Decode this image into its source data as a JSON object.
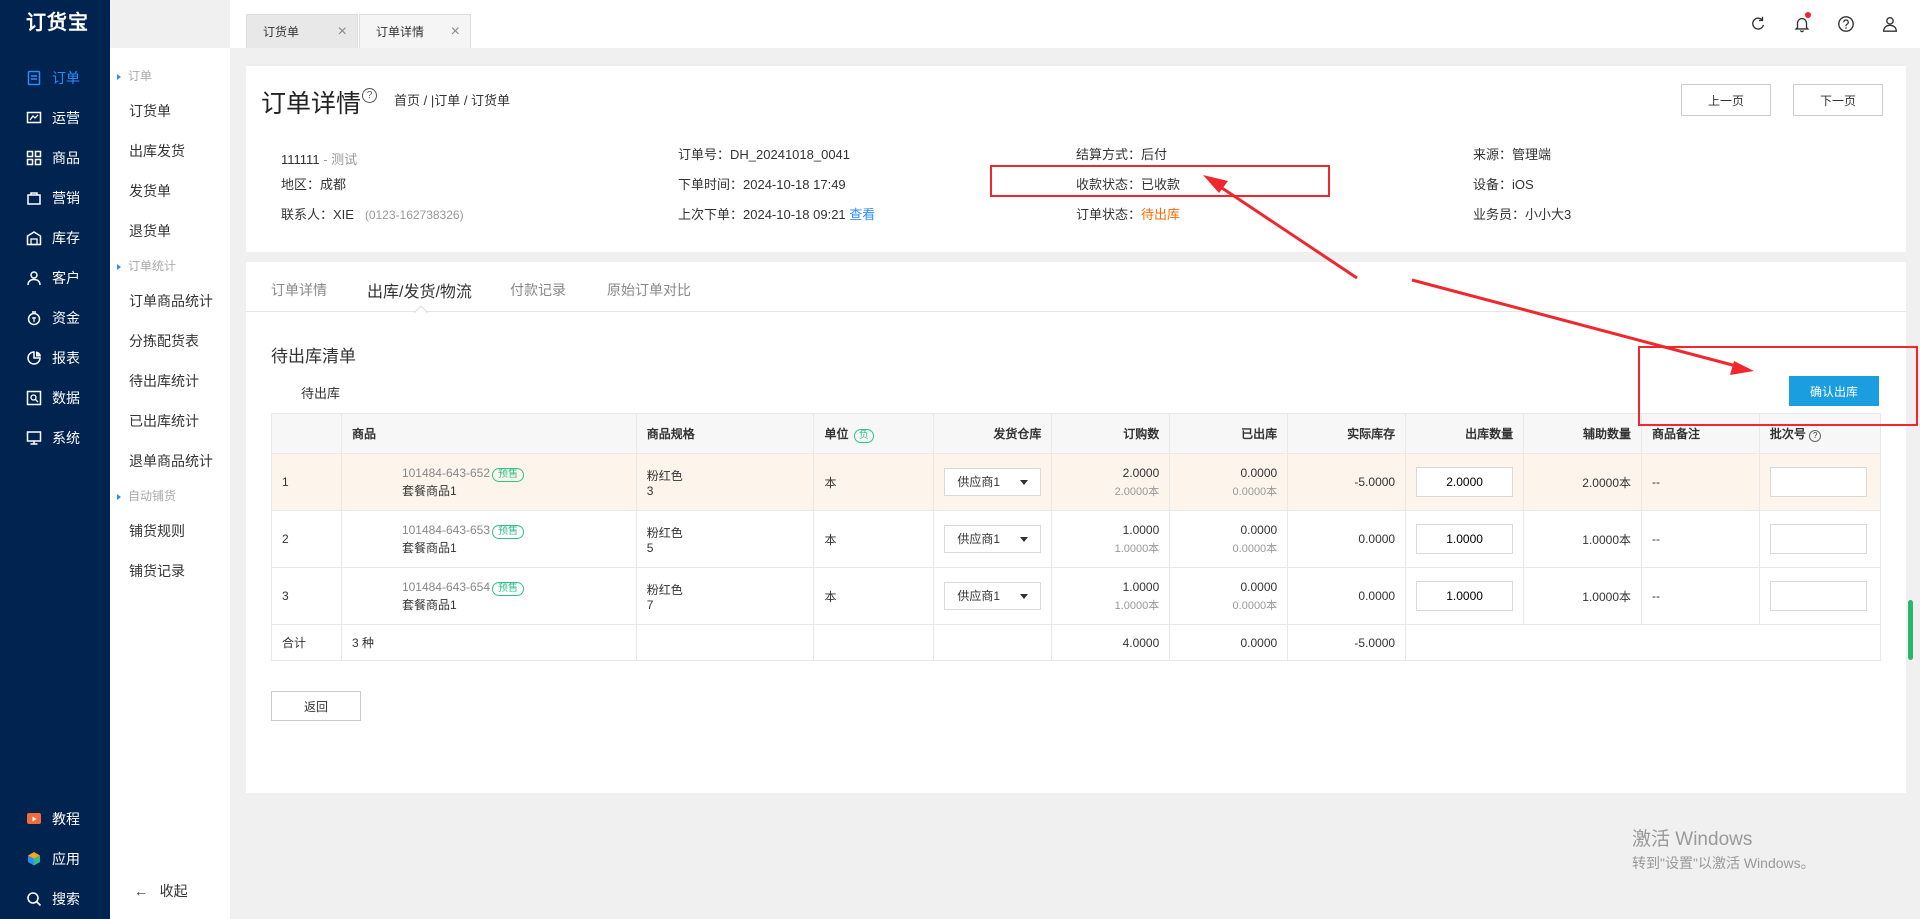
{
  "app": {
    "logo": "订货宝"
  },
  "nav": {
    "items": [
      {
        "label": "订单",
        "icon": "order-icon"
      },
      {
        "label": "运营",
        "icon": "operation-icon"
      },
      {
        "label": "商品",
        "icon": "grid-icon"
      },
      {
        "label": "营销",
        "icon": "marketing-icon"
      },
      {
        "label": "库存",
        "icon": "warehouse-icon"
      },
      {
        "label": "客户",
        "icon": "user-icon"
      },
      {
        "label": "资金",
        "icon": "money-icon"
      },
      {
        "label": "报表",
        "icon": "pie-chart-icon"
      },
      {
        "label": "数据",
        "icon": "data-icon"
      },
      {
        "label": "系统",
        "icon": "monitor-icon"
      }
    ],
    "bottom": [
      {
        "label": "教程",
        "icon": "video-icon"
      },
      {
        "label": "应用",
        "icon": "cube-icon"
      },
      {
        "label": "搜索",
        "icon": "search-icon"
      }
    ],
    "active_color": "#2b8cff"
  },
  "subnav": {
    "groups": [
      {
        "title": "订单",
        "items": [
          "订货单",
          "出库发货",
          "发货单",
          "退货单"
        ]
      },
      {
        "title": "订单统计",
        "items": [
          "订单商品统计",
          "分拣配货表",
          "待出库统计",
          "已出库统计",
          "退单商品统计"
        ]
      },
      {
        "title": "自动铺货",
        "items": [
          "铺货规则",
          "铺货记录"
        ]
      }
    ],
    "collapse": "收起"
  },
  "tabs": [
    {
      "label": "订货单"
    },
    {
      "label": "订单详情"
    }
  ],
  "page": {
    "title": "订单详情",
    "breadcrumb": "首页 / |订单 / 订货单",
    "prev": "上一页",
    "next": "下一页"
  },
  "info": {
    "customer": "111111",
    "customer_note": "- 测试",
    "region_label": "地区：",
    "region": "成都",
    "contact_label": "联系人：",
    "contact": "XIE",
    "contact_phone": "(0123-162738326)",
    "order_no_label": "订单号：",
    "order_no": "DH_20241018_0041",
    "order_time_label": "下单时间：",
    "order_time": "2024-10-18 17:49",
    "last_order_label": "上次下单：",
    "last_order": "2024-10-18 09:21",
    "view": "查看",
    "settle_label": "结算方式：",
    "settle": "后付",
    "pay_status_label": "收款状态：",
    "pay_status": "已收款",
    "order_status_label": "订单状态：",
    "order_status": "待出库",
    "source_label": "来源：",
    "source": "管理端",
    "device_label": "设备：",
    "device": "iOS",
    "sales_label": "业务员：",
    "sales": "小小大3"
  },
  "detail_tabs": [
    "订单详情",
    "出库/发货/物流",
    "付款记录",
    "原始订单对比"
  ],
  "section": {
    "title": "待出库清单",
    "sub_label": "待出库",
    "confirm": "确认出库"
  },
  "table": {
    "headers": {
      "product": "商品",
      "spec": "商品规格",
      "unit": "单位",
      "unit_tag": "负",
      "warehouse": "发货仓库",
      "ordered": "订购数",
      "shipped": "已出库",
      "stock": "实际库存",
      "out_qty": "出库数量",
      "aux_qty": "辅助数量",
      "remark": "商品备注",
      "batch": "批次号"
    },
    "rows": [
      {
        "idx": "1",
        "code": "101484-643-652",
        "tag": "预售",
        "name": "套餐商品1",
        "spec": "粉红色",
        "spec2": "3",
        "unit": "本",
        "warehouse": "供应商1",
        "ordered": "2.0000",
        "ordered_sub": "2.0000本",
        "shipped": "0.0000",
        "shipped_sub": "0.0000本",
        "stock": "-5.0000",
        "out_qty": "2.0000",
        "aux_qty": "2.0000本",
        "remark": "--"
      },
      {
        "idx": "2",
        "code": "101484-643-653",
        "tag": "预售",
        "name": "套餐商品1",
        "spec": "粉红色",
        "spec2": "5",
        "unit": "本",
        "warehouse": "供应商1",
        "ordered": "1.0000",
        "ordered_sub": "1.0000本",
        "shipped": "0.0000",
        "shipped_sub": "0.0000本",
        "stock": "0.0000",
        "out_qty": "1.0000",
        "aux_qty": "1.0000本",
        "remark": "--"
      },
      {
        "idx": "3",
        "code": "101484-643-654",
        "tag": "预售",
        "name": "套餐商品1",
        "spec": "粉红色",
        "spec2": "7",
        "unit": "本",
        "warehouse": "供应商1",
        "ordered": "1.0000",
        "ordered_sub": "1.0000本",
        "shipped": "0.0000",
        "shipped_sub": "0.0000本",
        "stock": "0.0000",
        "out_qty": "1.0000",
        "aux_qty": "1.0000本",
        "remark": "--"
      }
    ],
    "summary": {
      "label": "合计",
      "kinds": "3 种",
      "ordered": "4.0000",
      "shipped": "0.0000",
      "stock": "-5.0000"
    }
  },
  "back": "返回",
  "watermark": {
    "line1": "激活 Windows",
    "line2": "转到\"设置\"以激活 Windows。"
  },
  "colors": {
    "nav_bg": "#002350",
    "accent": "#2b8cff",
    "confirm": "#1a9ee0",
    "annotation": "#f0282d",
    "status_orange": "#ff6a00"
  }
}
